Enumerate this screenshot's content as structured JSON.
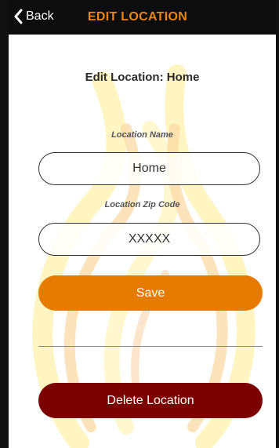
{
  "nav": {
    "back_label": "Back",
    "title": "EDIT LOCATION"
  },
  "page": {
    "title": "Edit Location: Home"
  },
  "form": {
    "name_label": "Location Name",
    "name_value": "Home",
    "zip_label": "Location Zip Code",
    "zip_value": "XXXXX",
    "save_label": "Save",
    "delete_label": "Delete Location"
  },
  "colors": {
    "nav_background": "#0d0d0d",
    "accent": "#e8861c",
    "save_button": "#e57b00",
    "delete_button": "#7d0000"
  },
  "icons": {
    "back": "chevron-left-icon",
    "background": "flame-watermark"
  }
}
